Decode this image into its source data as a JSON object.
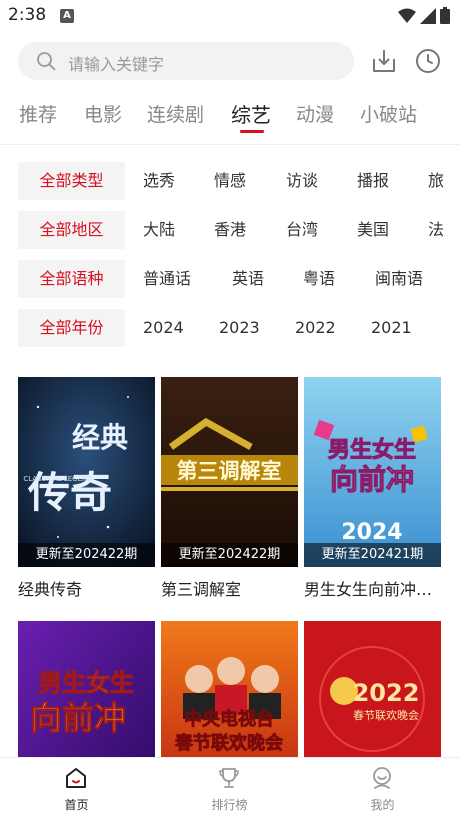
{
  "status_bar": {
    "time": "2:38",
    "notification_glyph": "A"
  },
  "search": {
    "placeholder": "请输入关键字"
  },
  "tabs": [
    {
      "label": "推荐",
      "active": false
    },
    {
      "label": "电影",
      "active": false
    },
    {
      "label": "连续剧",
      "active": false
    },
    {
      "label": "综艺",
      "active": true
    },
    {
      "label": "动漫",
      "active": false
    },
    {
      "label": "小破站",
      "active": false
    }
  ],
  "filters": {
    "type": {
      "selected": "全部类型",
      "options": [
        "选秀",
        "情感",
        "访谈",
        "播报",
        "旅"
      ]
    },
    "region": {
      "selected": "全部地区",
      "options": [
        "大陆",
        "香港",
        "台湾",
        "美国",
        "法"
      ]
    },
    "language": {
      "selected": "全部语种",
      "options": [
        "普通话",
        "英语",
        "粤语",
        "闽南语"
      ]
    },
    "year": {
      "selected": "全部年份",
      "options": [
        "2024",
        "2023",
        "2022",
        "2021"
      ]
    }
  },
  "shows": [
    {
      "title": "经典传奇",
      "badge": "更新至202422期",
      "poster_text_1": "经典",
      "poster_text_2": "传奇",
      "poster_text_3": "CLASSICAL LEGEND"
    },
    {
      "title": "第三调解室",
      "badge": "更新至202422期",
      "poster_text_1": "第三调解室"
    },
    {
      "title": "男生女生向前冲…",
      "badge": "更新至202421期",
      "poster_text_1": "男生女生",
      "poster_text_2": "向前冲",
      "poster_text_3": "2024"
    },
    {
      "title": "",
      "badge": "",
      "poster_text_1": "男生女生",
      "poster_text_2": "向前冲"
    },
    {
      "title": "",
      "badge": "",
      "poster_text_1": "中央电视台",
      "poster_text_2": "春节联欢晚会"
    },
    {
      "title": "",
      "badge": "",
      "poster_text_1": "2022",
      "poster_text_2": "春节联欢晚会"
    }
  ],
  "bottom_nav": [
    {
      "label": "首页",
      "icon": "home-icon",
      "active": true
    },
    {
      "label": "排行榜",
      "icon": "trophy-icon",
      "active": false
    },
    {
      "label": "我的",
      "icon": "profile-icon",
      "active": false
    }
  ],
  "colors": {
    "accent": "#d5101f",
    "chip_bg": "#f4f4f4",
    "search_bg": "#f2f2f2"
  }
}
